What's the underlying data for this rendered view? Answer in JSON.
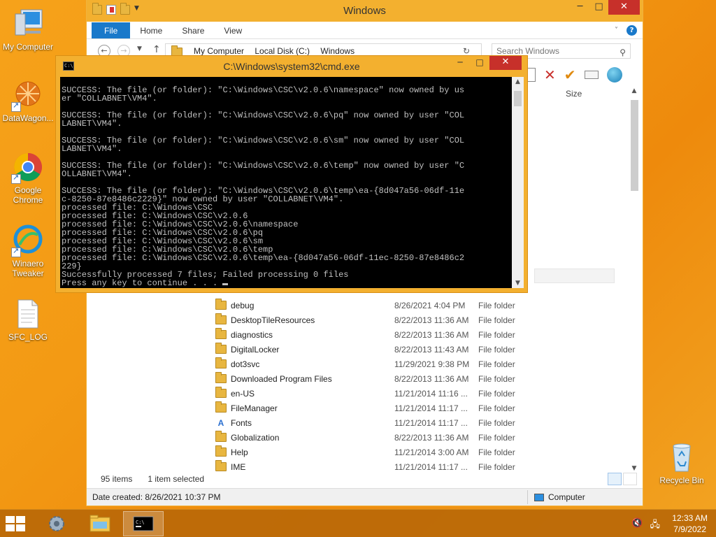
{
  "desktop": {
    "icons": [
      {
        "label": "My Computer"
      },
      {
        "label": "DataWagon..."
      },
      {
        "label": "Google Chrome"
      },
      {
        "label": "Winaero Tweaker"
      },
      {
        "label": "SFC_LOG"
      },
      {
        "label": "Recycle Bin"
      }
    ]
  },
  "explorer": {
    "title": "Windows",
    "ribbon_tabs": [
      "File",
      "Home",
      "Share",
      "View"
    ],
    "address_parts": [
      "My Computer",
      "Local Disk (C:)",
      "Windows"
    ],
    "search_placeholder": "Search Windows",
    "column_size_label": "Size",
    "files": [
      {
        "name": "debug",
        "date": "8/26/2021 4:04 PM",
        "type": "File folder"
      },
      {
        "name": "DesktopTileResources",
        "date": "8/22/2013 11:36 AM",
        "type": "File folder"
      },
      {
        "name": "diagnostics",
        "date": "8/22/2013 11:36 AM",
        "type": "File folder"
      },
      {
        "name": "DigitalLocker",
        "date": "8/22/2013 11:43 AM",
        "type": "File folder"
      },
      {
        "name": "dot3svc",
        "date": "11/29/2021 9:38 PM",
        "type": "File folder"
      },
      {
        "name": "Downloaded Program Files",
        "date": "8/22/2013 11:36 AM",
        "type": "File folder"
      },
      {
        "name": "en-US",
        "date": "11/21/2014 11:16 ...",
        "type": "File folder"
      },
      {
        "name": "FileManager",
        "date": "11/21/2014 11:17 ...",
        "type": "File folder"
      },
      {
        "name": "Fonts",
        "date": "11/21/2014 11:17 ...",
        "type": "File folder",
        "icon": "fonts-icon"
      },
      {
        "name": "Globalization",
        "date": "8/22/2013 11:36 AM",
        "type": "File folder"
      },
      {
        "name": "Help",
        "date": "11/21/2014 3:00 AM",
        "type": "File folder"
      },
      {
        "name": "IME",
        "date": "11/21/2014 11:17 ...",
        "type": "File folder"
      }
    ],
    "status": {
      "item_count": "95 items",
      "selected": "1 item selected"
    },
    "details": {
      "date_created": "Date created: 8/26/2021 10:37 PM",
      "location": "Computer"
    }
  },
  "cmd": {
    "title": "C:\\Windows\\system32\\cmd.exe",
    "lines": [
      "SUCCESS: The file (or folder): \"C:\\Windows\\CSC\\v2.0.6\\namespace\" now owned by us",
      "er \"COLLABNET\\VM4\".",
      "",
      "SUCCESS: The file (or folder): \"C:\\Windows\\CSC\\v2.0.6\\pq\" now owned by user \"COL",
      "LABNET\\VM4\".",
      "",
      "SUCCESS: The file (or folder): \"C:\\Windows\\CSC\\v2.0.6\\sm\" now owned by user \"COL",
      "LABNET\\VM4\".",
      "",
      "SUCCESS: The file (or folder): \"C:\\Windows\\CSC\\v2.0.6\\temp\" now owned by user \"C",
      "OLLABNET\\VM4\".",
      "",
      "SUCCESS: The file (or folder): \"C:\\Windows\\CSC\\v2.0.6\\temp\\ea-{8d047a56-06df-11e",
      "c-8250-87e8486c2229}\" now owned by user \"COLLABNET\\VM4\".",
      "processed file: C:\\Windows\\CSC",
      "processed file: C:\\Windows\\CSC\\v2.0.6",
      "processed file: C:\\Windows\\CSC\\v2.0.6\\namespace",
      "processed file: C:\\Windows\\CSC\\v2.0.6\\pq",
      "processed file: C:\\Windows\\CSC\\v2.0.6\\sm",
      "processed file: C:\\Windows\\CSC\\v2.0.6\\temp",
      "processed file: C:\\Windows\\CSC\\v2.0.6\\temp\\ea-{8d047a56-06df-11ec-8250-87e8486c2",
      "229}",
      "Successfully processed 7 files; Failed processing 0 files",
      "Press any key to continue . . . "
    ]
  },
  "taskbar": {
    "time": "12:33 AM",
    "date": "7/9/2022"
  },
  "colors": {
    "accent": "#f3b02f",
    "ribbon_file": "#1979ca",
    "close_red": "#c7302a",
    "console_bg": "#000000",
    "console_fg": "#c0c0c0"
  }
}
